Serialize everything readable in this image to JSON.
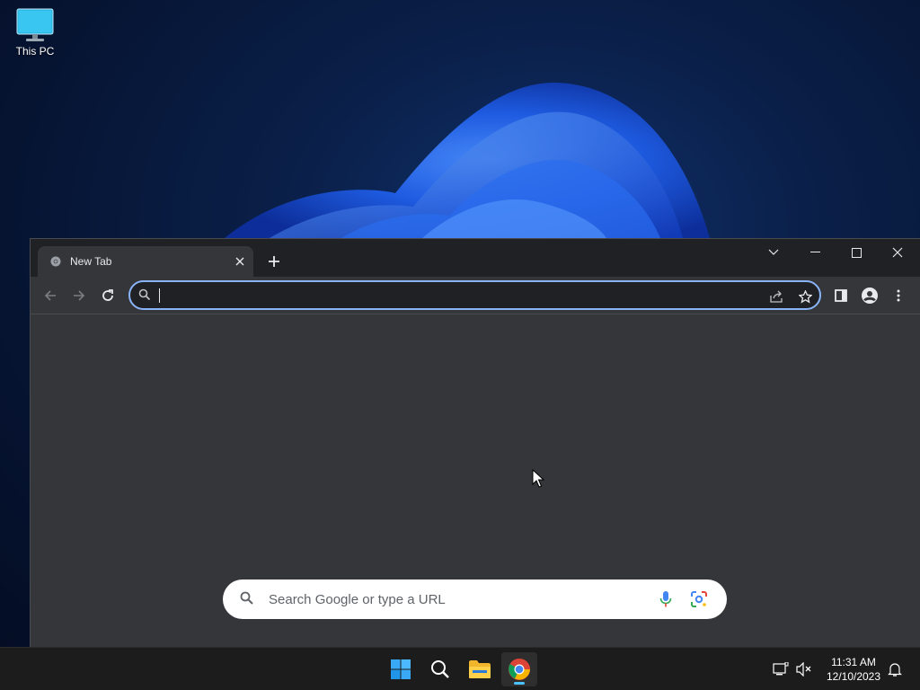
{
  "desktop": {
    "icons": [
      {
        "label": "This PC",
        "icon": "monitor-icon"
      }
    ]
  },
  "browser": {
    "tab": {
      "title": "New Tab",
      "icon": "chrome-favicon"
    },
    "window_controls": [
      "tab-search",
      "minimize",
      "maximize",
      "close"
    ],
    "omnibox": {
      "value": "",
      "placeholder": ""
    },
    "new_tab_page": {
      "search_placeholder": "Search Google or type a URL"
    }
  },
  "taskbar": {
    "apps": [
      "start",
      "search",
      "file-explorer",
      "chrome"
    ],
    "active_app": "chrome",
    "clock": {
      "time": "11:31 AM",
      "date": "12/10/2023"
    }
  },
  "colors": {
    "accent": "#8ab4f8",
    "tab_bg": "#35363a",
    "titlebar_bg": "#202124",
    "taskbar_bg": "#1c1c1c",
    "active_indicator": "#4cc2ff"
  }
}
